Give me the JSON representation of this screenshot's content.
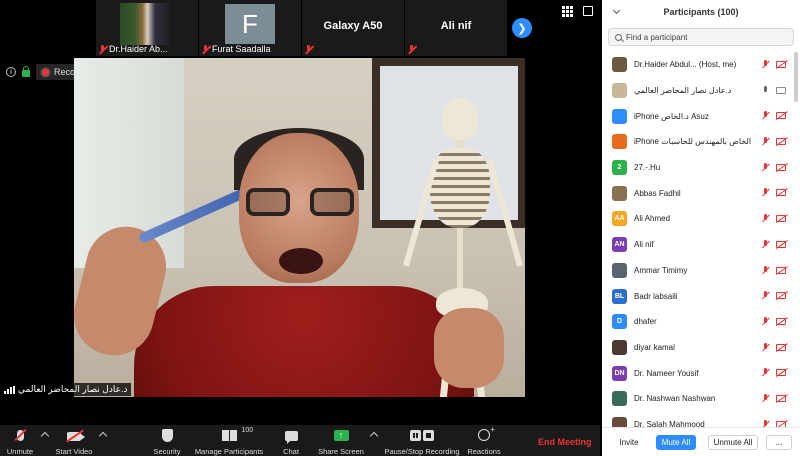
{
  "thumbnails": [
    {
      "label": "Dr.Haider Ab...",
      "type": "photo"
    },
    {
      "label": "Furat Saadalla",
      "initial": "F",
      "type": "initial"
    },
    {
      "label": "",
      "name": "Galaxy A50",
      "type": "name"
    },
    {
      "label": "",
      "name": "Ali nif",
      "type": "name"
    }
  ],
  "status": {
    "recording_label": "Recording..."
  },
  "speaker": {
    "name": "د.عادل نصار المحاضر العالمي"
  },
  "toolbar": {
    "unmute": "Unmute",
    "start_video": "Start Video",
    "security": "Security",
    "manage_participants": "Manage Participants",
    "participant_count": "100",
    "chat": "Chat",
    "share_screen": "Share Screen",
    "pause_stop_recording": "Pause/Stop Recording",
    "reactions": "Reactions",
    "end_meeting": "End Meeting"
  },
  "panel": {
    "title": "Participants (100)",
    "search_placeholder": "Find a participant",
    "participants": [
      {
        "name": "Dr.Haider Abdul... (Host, me)",
        "avatar_initials": "",
        "avatar_color": "#6b5a3e",
        "mic": "muted",
        "cam": "off"
      },
      {
        "name": "د.عادل نصار المحاضر العالمي",
        "avatar_initials": "",
        "avatar_color": "#c9b79a",
        "mic": "on",
        "cam": "plain"
      },
      {
        "name": "iPhone د.الخاص Asuz",
        "avatar_initials": "",
        "avatar_color": "#2d8cff",
        "mic": "muted",
        "cam": "off"
      },
      {
        "name": "iPhone الخاص بالمهندس للحاسبات",
        "avatar_initials": "",
        "avatar_color": "#e86a1c",
        "mic": "muted",
        "cam": "off"
      },
      {
        "name": "27.-.Hu",
        "avatar_initials": "2",
        "avatar_color": "#2bb24c",
        "mic": "muted",
        "cam": "off"
      },
      {
        "name": "Abbas Fadhil",
        "avatar_initials": "",
        "avatar_color": "#8a7250",
        "mic": "muted",
        "cam": "off"
      },
      {
        "name": "Ali Ahmed",
        "avatar_initials": "AA",
        "avatar_color": "#f5a623",
        "mic": "muted",
        "cam": "off"
      },
      {
        "name": "Ali nif",
        "avatar_initials": "AN",
        "avatar_color": "#7b3fb3",
        "mic": "muted",
        "cam": "off"
      },
      {
        "name": "Ammar Timimy",
        "avatar_initials": "",
        "avatar_color": "#5a6470",
        "mic": "muted",
        "cam": "off"
      },
      {
        "name": "Badr labsaili",
        "avatar_initials": "BL",
        "avatar_color": "#2d6fcf",
        "mic": "muted",
        "cam": "off"
      },
      {
        "name": "dhafer",
        "avatar_initials": "D",
        "avatar_color": "#2d8cff",
        "mic": "muted",
        "cam": "off"
      },
      {
        "name": "diyar kamal",
        "avatar_initials": "",
        "avatar_color": "#4a3a30",
        "mic": "muted",
        "cam": "off"
      },
      {
        "name": "Dr. Nameer Yousif",
        "avatar_initials": "DN",
        "avatar_color": "#7b3fb3",
        "mic": "muted",
        "cam": "off"
      },
      {
        "name": "Dr. Nashwan Nashwan",
        "avatar_initials": "",
        "avatar_color": "#3a6a5a",
        "mic": "muted",
        "cam": "off"
      },
      {
        "name": "Dr. Salah Mahmood",
        "avatar_initials": "",
        "avatar_color": "#6a4a3a",
        "mic": "muted",
        "cam": "off"
      }
    ],
    "footer": {
      "invite": "Invite",
      "mute_all": "Mute All",
      "unmute_all": "Unmute All",
      "more": "..."
    }
  }
}
